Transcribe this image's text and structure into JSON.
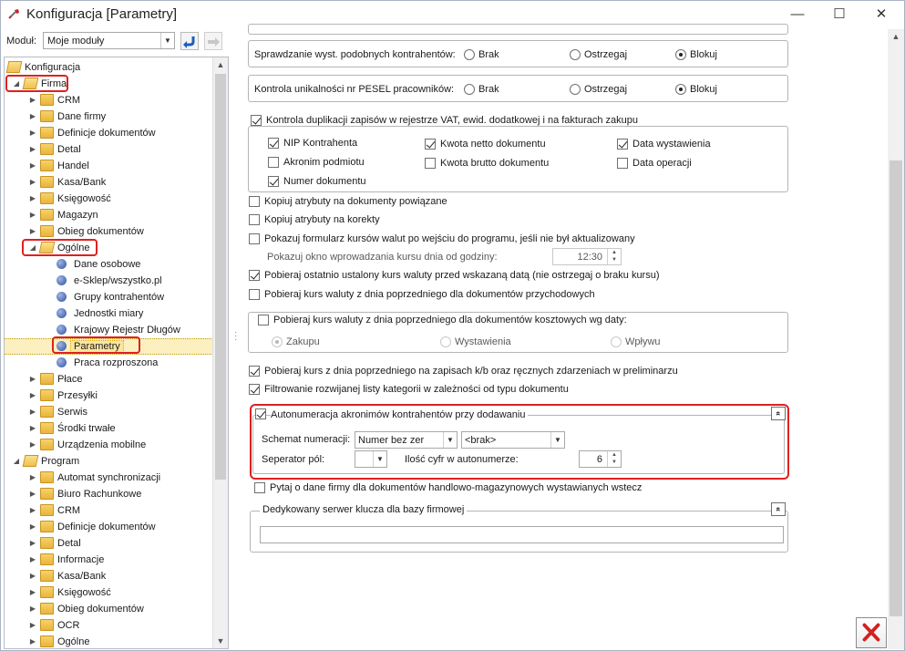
{
  "window": {
    "title": "Konfiguracja [Parametry]",
    "controls": {
      "minimize": "—",
      "maximize": "☐",
      "close": "✕"
    }
  },
  "toolbar": {
    "modul_label": "Moduł:",
    "modul_value": "Moje moduły"
  },
  "tree": {
    "items": [
      {
        "label": "Konfiguracja",
        "level": 0,
        "expander": "",
        "icon": "folder-open-icon"
      },
      {
        "label": "Firma",
        "level": 1,
        "expander": "◢",
        "icon": "folder-open-icon"
      },
      {
        "label": "CRM",
        "level": 2,
        "expander": "▶",
        "icon": "folder-icon"
      },
      {
        "label": "Dane firmy",
        "level": 2,
        "expander": "▶",
        "icon": "folder-icon"
      },
      {
        "label": "Definicje dokumentów",
        "level": 2,
        "expander": "▶",
        "icon": "folder-icon"
      },
      {
        "label": "Detal",
        "level": 2,
        "expander": "▶",
        "icon": "folder-icon"
      },
      {
        "label": "Handel",
        "level": 2,
        "expander": "▶",
        "icon": "folder-icon"
      },
      {
        "label": "Kasa/Bank",
        "level": 2,
        "expander": "▶",
        "icon": "folder-icon"
      },
      {
        "label": "Księgowość",
        "level": 2,
        "expander": "▶",
        "icon": "folder-icon"
      },
      {
        "label": "Magazyn",
        "level": 2,
        "expander": "▶",
        "icon": "folder-icon"
      },
      {
        "label": "Obieg dokumentów",
        "level": 2,
        "expander": "▶",
        "icon": "folder-icon"
      },
      {
        "label": "Ogólne",
        "level": 2,
        "expander": "◢",
        "icon": "folder-open-icon"
      },
      {
        "label": "Dane osobowe",
        "level": 3,
        "expander": "",
        "icon": "document-icon"
      },
      {
        "label": "e-Sklep/wszystko.pl",
        "level": 3,
        "expander": "",
        "icon": "document-icon"
      },
      {
        "label": "Grupy kontrahentów",
        "level": 3,
        "expander": "",
        "icon": "document-icon"
      },
      {
        "label": "Jednostki miary",
        "level": 3,
        "expander": "",
        "icon": "document-icon"
      },
      {
        "label": "Krajowy Rejestr Długów",
        "level": 3,
        "expander": "",
        "icon": "document-icon"
      },
      {
        "label": "Parametry",
        "level": 3,
        "expander": "",
        "icon": "document-icon",
        "selected": true
      },
      {
        "label": "Praca rozproszona",
        "level": 3,
        "expander": "",
        "icon": "document-icon"
      },
      {
        "label": "Płace",
        "level": 2,
        "expander": "▶",
        "icon": "folder-icon"
      },
      {
        "label": "Przesyłki",
        "level": 2,
        "expander": "▶",
        "icon": "folder-icon"
      },
      {
        "label": "Serwis",
        "level": 2,
        "expander": "▶",
        "icon": "folder-icon"
      },
      {
        "label": "Środki trwałe",
        "level": 2,
        "expander": "▶",
        "icon": "folder-icon"
      },
      {
        "label": "Urządzenia mobilne",
        "level": 2,
        "expander": "▶",
        "icon": "folder-icon"
      },
      {
        "label": "Program",
        "level": 1,
        "expander": "◢",
        "icon": "folder-open-icon"
      },
      {
        "label": "Automat synchronizacji",
        "level": 2,
        "expander": "▶",
        "icon": "folder-icon"
      },
      {
        "label": "Biuro Rachunkowe",
        "level": 2,
        "expander": "▶",
        "icon": "folder-icon"
      },
      {
        "label": "CRM",
        "level": 2,
        "expander": "▶",
        "icon": "folder-icon"
      },
      {
        "label": "Definicje dokumentów",
        "level": 2,
        "expander": "▶",
        "icon": "folder-icon"
      },
      {
        "label": "Detal",
        "level": 2,
        "expander": "▶",
        "icon": "folder-icon"
      },
      {
        "label": "Informacje",
        "level": 2,
        "expander": "▶",
        "icon": "folder-icon"
      },
      {
        "label": "Kasa/Bank",
        "level": 2,
        "expander": "▶",
        "icon": "folder-icon"
      },
      {
        "label": "Księgowość",
        "level": 2,
        "expander": "▶",
        "icon": "folder-icon"
      },
      {
        "label": "Obieg dokumentów",
        "level": 2,
        "expander": "▶",
        "icon": "folder-icon"
      },
      {
        "label": "OCR",
        "level": 2,
        "expander": "▶",
        "icon": "folder-icon"
      },
      {
        "label": "Ogólne",
        "level": 2,
        "expander": "▶",
        "icon": "folder-icon"
      }
    ]
  },
  "settings": {
    "similar_contractors": {
      "label": "Sprawdzanie wyst. podobnych kontrahentów:",
      "options": [
        "Brak",
        "Ostrzegaj",
        "Blokuj"
      ],
      "selected": "Blokuj"
    },
    "pesel_uniqueness": {
      "label": "Kontrola unikalności nr PESEL pracowników:",
      "options": [
        "Brak",
        "Ostrzegaj",
        "Blokuj"
      ],
      "selected": "Blokuj"
    },
    "duplicate_control": {
      "label": "Kontrola duplikacji zapisów w rejestrze VAT, ewid. dodatkowej i na fakturach zakupu",
      "checked": true,
      "nip": {
        "label": "NIP Kontrahenta",
        "checked": true
      },
      "akronim": {
        "label": "Akronim podmiotu",
        "checked": false
      },
      "numer": {
        "label": "Numer dokumentu",
        "checked": true
      },
      "kwota_netto": {
        "label": "Kwota netto dokumentu",
        "checked": true
      },
      "kwota_brutto": {
        "label": "Kwota brutto dokumentu",
        "checked": false
      },
      "data_wystawienia": {
        "label": "Data wystawienia",
        "checked": true
      },
      "data_operacji": {
        "label": "Data operacji",
        "checked": false
      }
    },
    "copy_attr_related": {
      "label": "Kopiuj atrybuty na dokumenty powiązane",
      "checked": false
    },
    "copy_attr_corrections": {
      "label": "Kopiuj atrybuty na korekty",
      "checked": false
    },
    "show_rates_form": {
      "label": "Pokazuj formularz kursów walut po wejściu do programu, jeśli nie był aktualizowany",
      "checked": false
    },
    "show_rates_window": {
      "label": "Pokazuj okno wprowadzania kursu dnia od godziny:",
      "value": "12:30"
    },
    "last_rate": {
      "label": "Pobieraj ostatnio ustalony kurs waluty przed wskazaną datą (nie ostrzegaj o braku kursu)",
      "checked": true
    },
    "prev_day_income": {
      "label": "Pobieraj kurs waluty z dnia poprzedniego dla dokumentów przychodowych",
      "checked": false
    },
    "prev_day_cost": {
      "label": "Pobieraj kurs waluty z dnia poprzedniego dla dokumentów kosztowych wg daty:",
      "checked": false,
      "options": [
        "Zakupu",
        "Wystawienia",
        "Wpływu"
      ],
      "selected": "Zakupu"
    },
    "prev_day_kb": {
      "label": "Pobieraj kurs z dnia poprzedniego na zapisach k/b oraz ręcznych zdarzeniach w preliminarzu",
      "checked": true
    },
    "filter_categories": {
      "label": "Filtrowanie rozwijanej listy kategorii w zależności od typu dokumentu",
      "checked": true
    },
    "autonumeracja": {
      "label": "Autonumeracja akronimów kontrahentów przy dodawaniu",
      "checked": true,
      "schemat_label": "Schemat numeracji:",
      "schemat_value": "Numer bez zer",
      "schemat_second_value": "<brak>",
      "separator_label": "Seperator pól:",
      "separator_value": "",
      "digits_label": "Ilość cyfr w autonumerze:",
      "digits_value": "6"
    },
    "ask_company_data": {
      "label": "Pytaj o dane firmy dla dokumentów handlowo-magazynowych wystawianych wstecz",
      "checked": false
    },
    "dedicated_server": {
      "label": "Dedykowany serwer klucza dla bazy firmowej",
      "value": ""
    }
  },
  "icons": {
    "collapse": "»",
    "dropdown": "▼",
    "spin_up": "▲",
    "spin_down": "▼"
  },
  "colors": {
    "highlight_border": "#e02020",
    "selection": "#fcefc0",
    "close_x": "#d42020"
  }
}
